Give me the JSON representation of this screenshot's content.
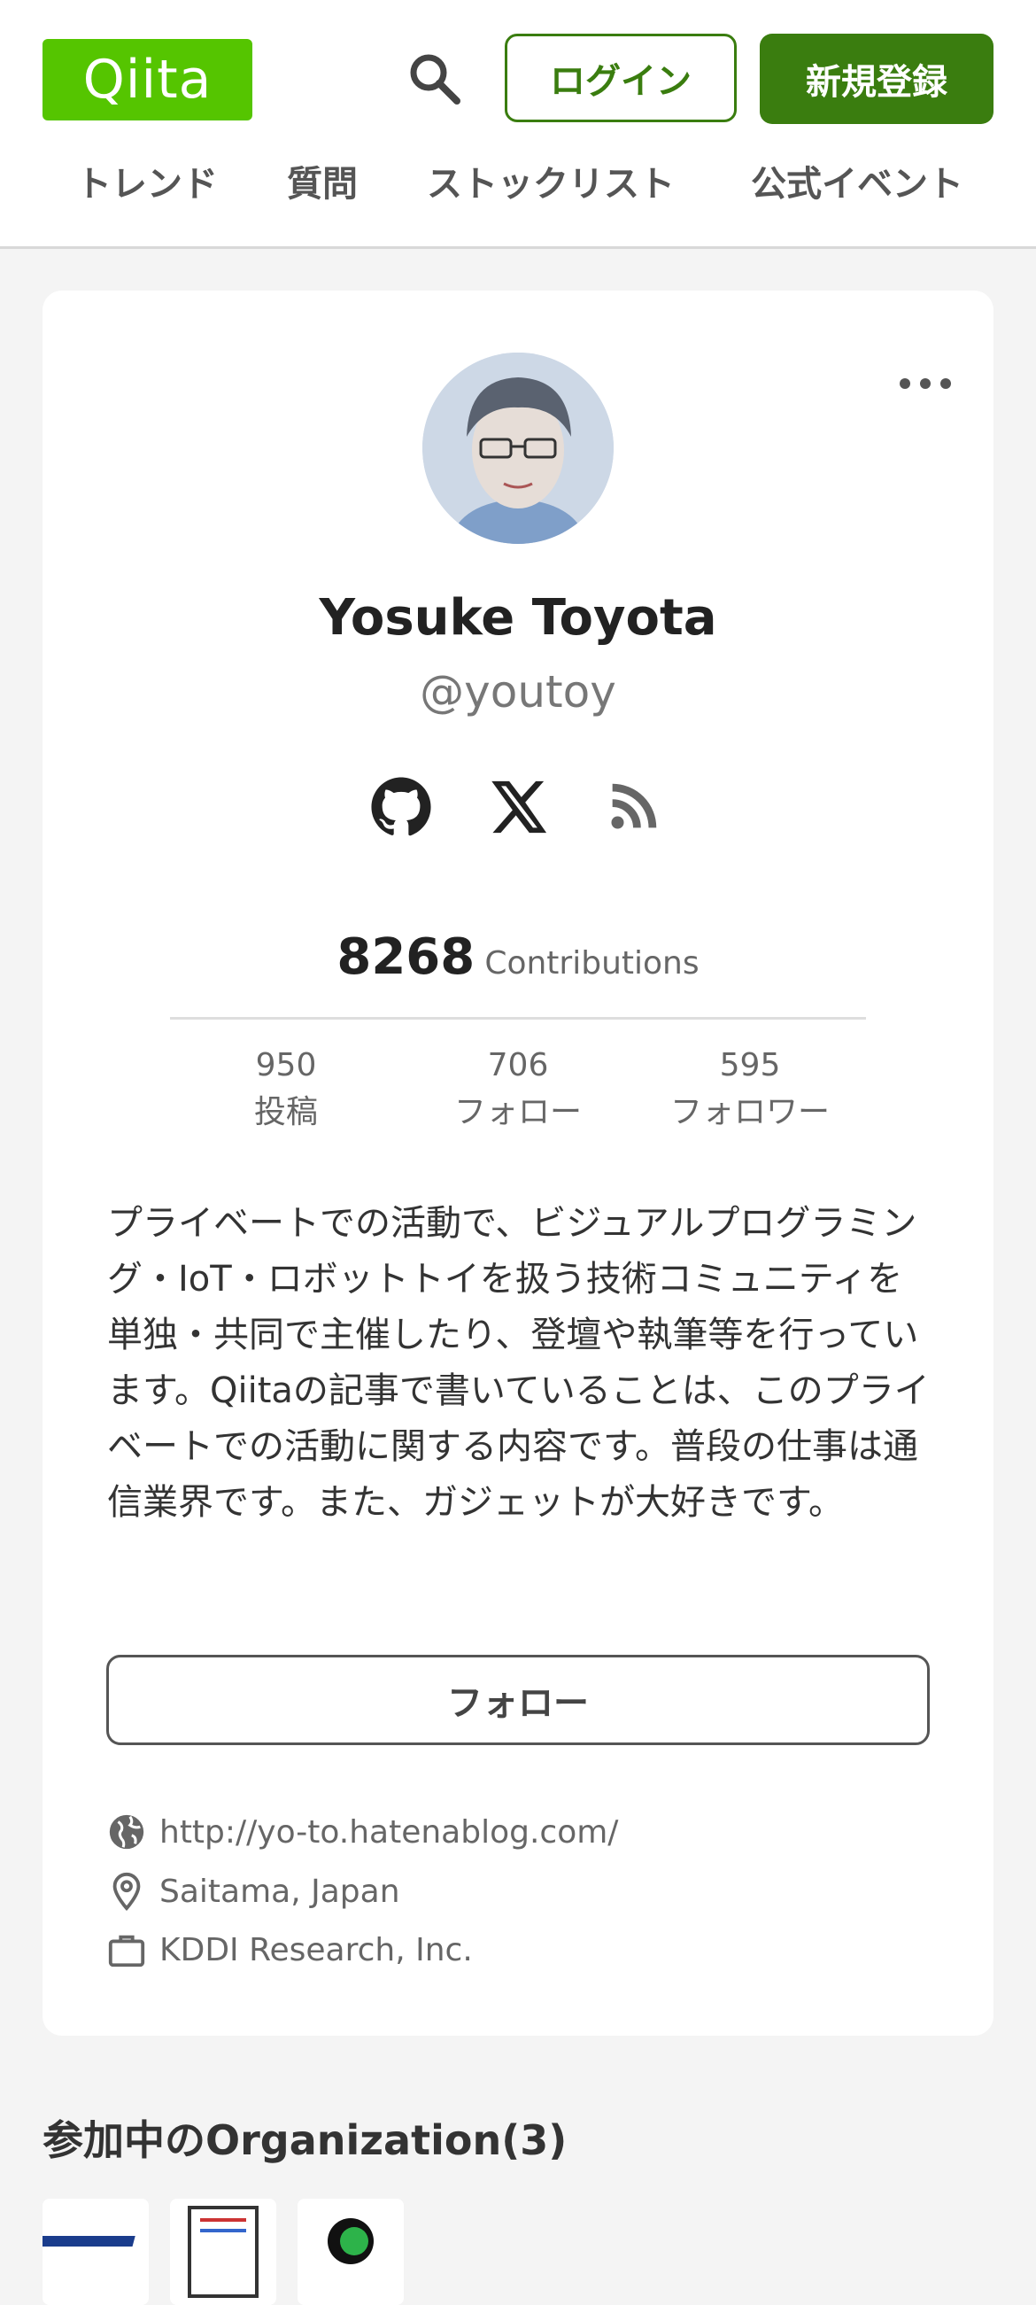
{
  "header": {
    "logo_text": "Qiita",
    "login_label": "ログイン",
    "signup_label": "新規登録",
    "search_icon": "search-icon",
    "brand_color": "#55c500",
    "accent_color": "#3a7d0f"
  },
  "nav": {
    "items": [
      {
        "label": "トレンド"
      },
      {
        "label": "質問"
      },
      {
        "label": "ストックリスト"
      },
      {
        "label": "公式イベント"
      }
    ]
  },
  "profile": {
    "name": "Yosuke Toyota",
    "handle": "@youtoy",
    "social_icons": [
      "github-icon",
      "x-icon",
      "rss-icon"
    ],
    "contributions_value": "8268",
    "contributions_label": "Contributions",
    "stats": [
      {
        "value": "950",
        "label": "投稿"
      },
      {
        "value": "706",
        "label": "フォロー"
      },
      {
        "value": "595",
        "label": "フォロワー"
      }
    ],
    "bio": "プライベートでの活動で、ビジュアルプログラミング・IoT・ロボットトイを扱う技術コミュニティを単独・共同で主催したり、登壇や執筆等を行っています。Qiitaの記事で書いていることは、このプライベートでの活動に関する内容です。普段の仕事は通信業界です。また、ガジェットが大好きです。",
    "follow_label": "フォロー",
    "website": "http://yo-to.hatenablog.com/",
    "location": "Saitama, Japan",
    "organization": "KDDI Research, Inc."
  },
  "organizations": {
    "title": "参加中のOrganization(3)"
  }
}
